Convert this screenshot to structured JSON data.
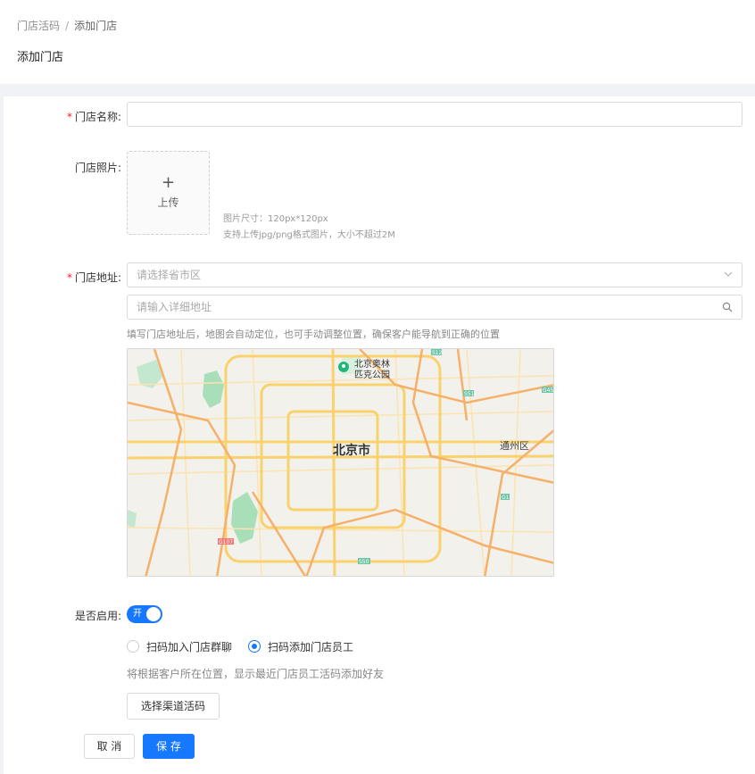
{
  "header": {
    "breadcrumb": [
      "门店活码",
      "添加门店"
    ],
    "separator": "/",
    "title": "添加门店"
  },
  "form": {
    "name": {
      "label": "门店名称:",
      "value": ""
    },
    "photo": {
      "label": "门店照片:",
      "upload_icon": "plus-icon",
      "upload_label": "上传",
      "hint_size": "图片尺寸：120px*120px",
      "hint_format": "支持上传jpg/png格式图片，大小不超过2M"
    },
    "address": {
      "label": "门店地址:",
      "region_placeholder": "请选择省市区",
      "detail_placeholder": "请输入详细地址",
      "hint": "填写门店地址后，地图会自动定位，也可手动调整位置，确保客户能导航到正确的位置"
    },
    "map": {
      "city_label": "北京市",
      "district_label": "通州区",
      "poi_label_line1": "北京奥林",
      "poi_label_line2": "匹克公园",
      "road_badges": [
        "G7",
        "S12",
        "S51",
        "G45",
        "G1",
        "G107",
        "S50",
        "G4"
      ]
    },
    "enable": {
      "label": "是否启用:",
      "switch_text": "开",
      "on": true
    },
    "mode": {
      "options": [
        "扫码加入门店群聊",
        "扫码添加门店员工"
      ],
      "selected_index": 1,
      "hint": "将根据客户所在位置，显示最近门店员工活码添加好友"
    },
    "channel_button": "选择渠道活码"
  },
  "footer": {
    "cancel": "取 消",
    "save": "保 存"
  },
  "colors": {
    "primary": "#1677ff",
    "required": "#f5222d"
  }
}
